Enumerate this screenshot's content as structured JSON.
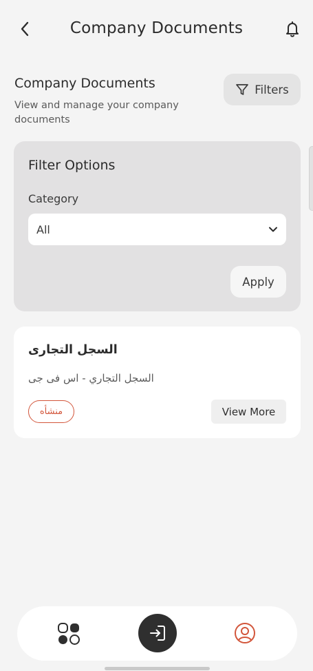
{
  "header": {
    "title": "Company Documents",
    "back_icon": "chevron-left-icon",
    "bell_icon": "bell-icon"
  },
  "section": {
    "title": "Company Documents",
    "subtitle": "View and manage your company documents",
    "filters_label": "Filters",
    "filters_icon": "filter-funnel-icon"
  },
  "filter_panel": {
    "title": "Filter Options",
    "category_label": "Category",
    "category_value": "All",
    "apply_label": "Apply"
  },
  "documents": [
    {
      "title": "السجل التجارى",
      "subtitle": "السجل التجاري - اس فى جى",
      "status": "منشأه",
      "action_label": "View More"
    }
  ],
  "bottom_nav": {
    "items": [
      "apps-grid-icon",
      "login-icon",
      "profile-icon"
    ],
    "active_color": "#d2553a",
    "center_bg": "#2f2f2f"
  },
  "colors": {
    "accent": "#d2553a",
    "background": "#f4f4f4",
    "panel": "#e2e1e2"
  }
}
